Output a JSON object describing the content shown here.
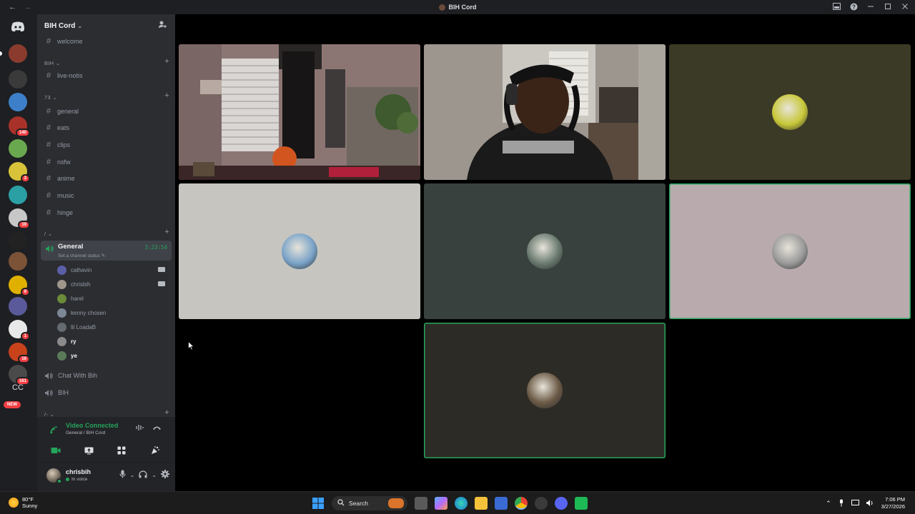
{
  "window": {
    "title": "BIH Cord",
    "back_glyph": "←",
    "forward_glyph": "→"
  },
  "server_rail": {
    "items": [
      {
        "name": "home",
        "icon": "discord-logo"
      },
      {
        "name": "server-1",
        "color": "#8a3b2d",
        "badge": ""
      },
      {
        "name": "server-2",
        "color": "#3a3a3a",
        "badge": ""
      },
      {
        "name": "server-3",
        "color": "#3d7fc9",
        "badge": ""
      },
      {
        "name": "server-4",
        "color": "#a8322a",
        "badge": "140"
      },
      {
        "name": "server-5",
        "color": "#6aa84f",
        "badge": ""
      },
      {
        "name": "server-6",
        "color": "#d7c23a",
        "badge": "3"
      },
      {
        "name": "server-7",
        "color": "#2aa0a4",
        "badge": ""
      },
      {
        "name": "server-8",
        "color": "#c7c7c7",
        "badge": "19"
      },
      {
        "name": "server-9",
        "color": "#222222",
        "badge": ""
      },
      {
        "name": "server-10",
        "color": "#7d5338",
        "badge": ""
      },
      {
        "name": "server-11",
        "color": "#e0b000",
        "badge": "9"
      },
      {
        "name": "server-12",
        "color": "#5a5a9a",
        "badge": ""
      },
      {
        "name": "server-13",
        "color": "#e8e8e8",
        "badge": "1"
      },
      {
        "name": "server-14",
        "color": "#c8421c",
        "badge": "16"
      },
      {
        "name": "server-15",
        "color": "#4a4a4a",
        "badge": "161"
      }
    ],
    "cc_label": "CC",
    "new_label": "NEW"
  },
  "sidebar": {
    "guild_name": "BIH Cord",
    "channels_top": [
      {
        "name": "welcome"
      }
    ],
    "category_bih": "BIH",
    "channels_bih": [
      {
        "name": "live-notis"
      }
    ],
    "category_73": "73",
    "channels_73": [
      {
        "name": "general"
      },
      {
        "name": "eats"
      },
      {
        "name": "clips"
      },
      {
        "name": "nsfw"
      },
      {
        "name": "anime"
      },
      {
        "name": "music"
      },
      {
        "name": "hinge"
      }
    ],
    "category_slash": "/",
    "voice_channel": {
      "name": "General",
      "status": "Set a channel status",
      "timer": "3:23:54"
    },
    "voice_users": [
      {
        "name": "calhavin",
        "camera": true,
        "color": "#5b5fa8"
      },
      {
        "name": "chrisbih",
        "camera": true,
        "color": "#a0968c"
      },
      {
        "name": "harel",
        "camera": false,
        "color": "#6b8a3a"
      },
      {
        "name": "kenny chosen",
        "camera": false,
        "color": "#7d8796"
      },
      {
        "name": "lil LoadaB",
        "camera": false,
        "color": "#646b70"
      },
      {
        "name": "ry",
        "camera": false,
        "color": "#8a8a8a"
      },
      {
        "name": "ye",
        "camera": false,
        "color": "#5a7a5a"
      }
    ],
    "voice_channels_more": [
      {
        "name": "Chat With Bih"
      },
      {
        "name": "BIH"
      }
    ],
    "category_more": "/-"
  },
  "voice_panel": {
    "title": "Video Connected",
    "subtitle": "General / BIH Cord"
  },
  "user_panel": {
    "username": "chrisbih",
    "status": "In voice"
  },
  "video_tiles": [
    {
      "name": "tile-video-1",
      "kind": "video",
      "speaking": false
    },
    {
      "name": "tile-video-2",
      "kind": "video",
      "speaking": false
    },
    {
      "name": "tile-avatar-1",
      "kind": "avatar",
      "bg": "#3b3a26",
      "avatar_color": "#c8c83a",
      "speaking": false
    },
    {
      "name": "tile-avatar-2",
      "kind": "avatar",
      "bg": "#c6c5c0",
      "avatar_color": "#7aa3c8",
      "speaking": false
    },
    {
      "name": "tile-avatar-3",
      "kind": "avatar",
      "bg": "#38413e",
      "avatar_color": "#6a7a70",
      "speaking": false
    },
    {
      "name": "tile-avatar-4",
      "kind": "avatar",
      "bg": "#b9abad",
      "avatar_color": "#9a9a9a",
      "speaking": true
    },
    {
      "name": "tile-avatar-5",
      "kind": "avatar",
      "bg": "#2d2b26",
      "avatar_color": "#6b5a46",
      "speaking": true
    }
  ],
  "taskbar": {
    "weather_temp": "80°F",
    "weather_desc": "Sunny",
    "search_label": "Search",
    "time": "7:06 PM",
    "date": "3/27/2026"
  },
  "colors": {
    "accent_green": "#23a55a",
    "badge_red": "#f23f43",
    "sidebar_bg": "#2b2d31",
    "rail_bg": "#1e1f22"
  }
}
